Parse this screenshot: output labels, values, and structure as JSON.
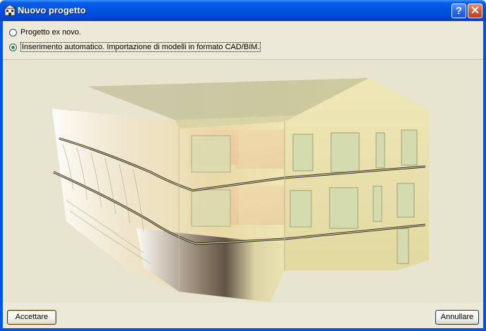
{
  "window": {
    "title": "Nuovo progetto",
    "help_button": "?",
    "close_button": "✕"
  },
  "options": [
    {
      "label": "Progetto ex novo.",
      "selected": false
    },
    {
      "label": "Inserimento automatico. Importazione di modelli in formato CAD/BIM.",
      "selected": true
    }
  ],
  "preview": {
    "description_icon": "building-3d-preview"
  },
  "footer": {
    "accept_label": "Accettare",
    "cancel_label": "Annullare"
  },
  "colors": {
    "titlebar": "#0055e5",
    "panel": "#ece9d8",
    "selected_radio": "#21a121"
  }
}
